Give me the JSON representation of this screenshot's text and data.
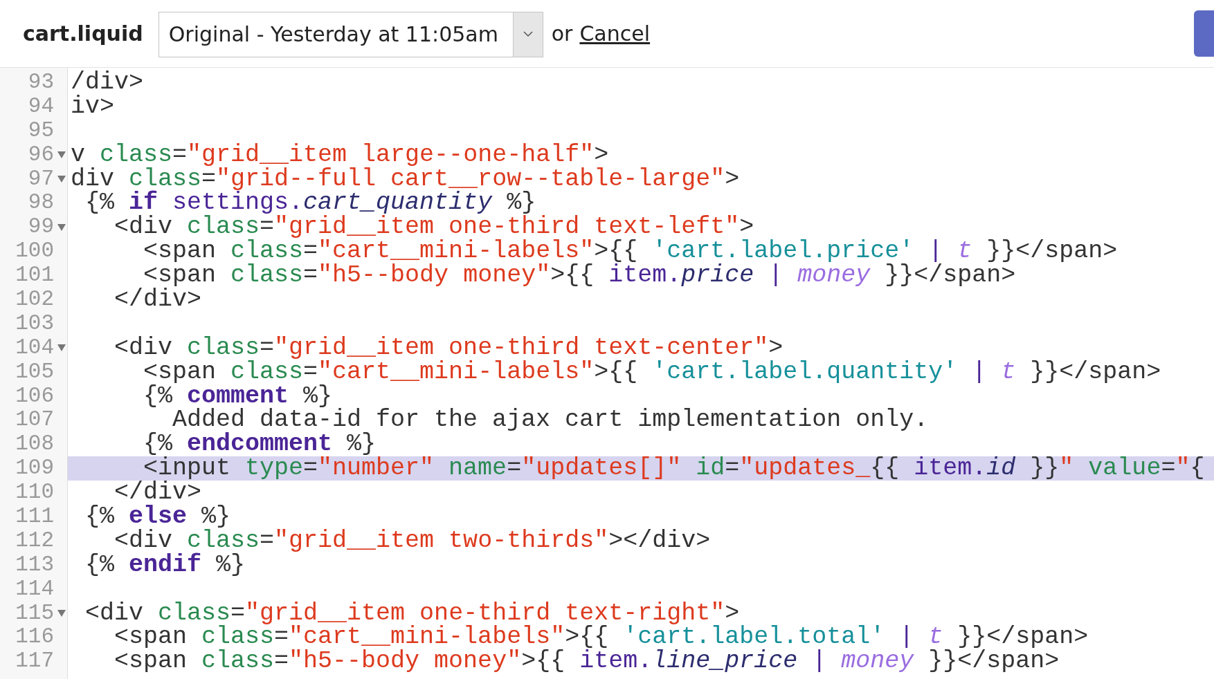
{
  "header": {
    "file_name": "cart.liquid",
    "version_select": {
      "value": "Original - Yesterday at 11:05am"
    },
    "or_text": "or",
    "cancel_link": "Cancel"
  },
  "editor": {
    "lines": [
      {
        "number": "93",
        "foldable": false,
        "selected": false,
        "tokens": [
          {
            "kind": "plain",
            "text": "/div>"
          }
        ]
      },
      {
        "number": "94",
        "foldable": false,
        "selected": false,
        "tokens": [
          {
            "kind": "plain",
            "text": "iv>"
          }
        ]
      },
      {
        "number": "95",
        "foldable": false,
        "selected": false
      },
      {
        "number": "96",
        "foldable": true,
        "selected": false,
        "tokens": [
          {
            "kind": "plain",
            "text": "v "
          },
          {
            "kind": "attr",
            "text": "class"
          },
          {
            "kind": "plain",
            "text": "="
          },
          {
            "kind": "string",
            "text": "\"grid__item large--one-half\""
          },
          {
            "kind": "plain",
            "text": ">"
          }
        ]
      },
      {
        "number": "97",
        "foldable": true,
        "selected": false,
        "tokens": [
          {
            "kind": "plain",
            "text": "div "
          },
          {
            "kind": "attr",
            "text": "class"
          },
          {
            "kind": "plain",
            "text": "="
          },
          {
            "kind": "string",
            "text": "\"grid--full cart__row--table-large\""
          },
          {
            "kind": "plain",
            "text": ">"
          }
        ]
      },
      {
        "number": "98",
        "foldable": false,
        "selected": false,
        "tokens": [
          {
            "kind": "plain",
            "text": " {% "
          },
          {
            "kind": "keyword",
            "text": "if"
          },
          {
            "kind": "variable",
            "text": " settings."
          },
          {
            "kind": "property",
            "text": "cart_quantity"
          },
          {
            "kind": "plain",
            "text": " %}"
          }
        ]
      },
      {
        "number": "99",
        "foldable": true,
        "selected": false,
        "tokens": [
          {
            "kind": "plain",
            "text": "   <div "
          },
          {
            "kind": "attr",
            "text": "class"
          },
          {
            "kind": "plain",
            "text": "="
          },
          {
            "kind": "string",
            "text": "\"grid__item one-third text-left\""
          },
          {
            "kind": "plain",
            "text": ">"
          }
        ]
      },
      {
        "number": "100",
        "foldable": false,
        "selected": false,
        "tokens": [
          {
            "kind": "plain",
            "text": "     <span "
          },
          {
            "kind": "attr",
            "text": "class"
          },
          {
            "kind": "plain",
            "text": "="
          },
          {
            "kind": "string",
            "text": "\"cart__mini-labels\""
          },
          {
            "kind": "plain",
            "text": ">{{ "
          },
          {
            "kind": "literal",
            "text": "'cart.label.price'"
          },
          {
            "kind": "pipe",
            "text": " | "
          },
          {
            "kind": "filter",
            "text": "t"
          },
          {
            "kind": "plain",
            "text": " }}</span>"
          }
        ]
      },
      {
        "number": "101",
        "foldable": false,
        "selected": false,
        "tokens": [
          {
            "kind": "plain",
            "text": "     <span "
          },
          {
            "kind": "attr",
            "text": "class"
          },
          {
            "kind": "plain",
            "text": "="
          },
          {
            "kind": "string",
            "text": "\"h5--body money\""
          },
          {
            "kind": "plain",
            "text": ">{{ "
          },
          {
            "kind": "variable",
            "text": "item."
          },
          {
            "kind": "property",
            "text": "price"
          },
          {
            "kind": "pipe",
            "text": " | "
          },
          {
            "kind": "filter",
            "text": "money"
          },
          {
            "kind": "plain",
            "text": " }}</span>"
          }
        ]
      },
      {
        "number": "102",
        "foldable": false,
        "selected": false,
        "tokens": [
          {
            "kind": "plain",
            "text": "   </div>"
          }
        ]
      },
      {
        "number": "103",
        "foldable": false,
        "selected": false
      },
      {
        "number": "104",
        "foldable": true,
        "selected": false,
        "tokens": [
          {
            "kind": "plain",
            "text": "   <div "
          },
          {
            "kind": "attr",
            "text": "class"
          },
          {
            "kind": "plain",
            "text": "="
          },
          {
            "kind": "string",
            "text": "\"grid__item one-third text-center\""
          },
          {
            "kind": "plain",
            "text": ">"
          }
        ]
      },
      {
        "number": "105",
        "foldable": false,
        "selected": false,
        "tokens": [
          {
            "kind": "plain",
            "text": "     <span "
          },
          {
            "kind": "attr",
            "text": "class"
          },
          {
            "kind": "plain",
            "text": "="
          },
          {
            "kind": "string",
            "text": "\"cart__mini-labels\""
          },
          {
            "kind": "plain",
            "text": ">{{ "
          },
          {
            "kind": "literal",
            "text": "'cart.label.quantity'"
          },
          {
            "kind": "pipe",
            "text": " | "
          },
          {
            "kind": "filter",
            "text": "t"
          },
          {
            "kind": "plain",
            "text": " }}</span>"
          }
        ]
      },
      {
        "number": "106",
        "foldable": false,
        "selected": false,
        "tokens": [
          {
            "kind": "plain",
            "text": "     {% "
          },
          {
            "kind": "keyword",
            "text": "comment"
          },
          {
            "kind": "plain",
            "text": " %}"
          }
        ]
      },
      {
        "number": "107",
        "foldable": false,
        "selected": false,
        "tokens": [
          {
            "kind": "plain",
            "text": "       Added data-id for the ajax cart implementation only."
          }
        ]
      },
      {
        "number": "108",
        "foldable": false,
        "selected": false,
        "tokens": [
          {
            "kind": "plain",
            "text": "     {% "
          },
          {
            "kind": "keyword",
            "text": "endcomment"
          },
          {
            "kind": "plain",
            "text": " %}"
          }
        ]
      },
      {
        "number": "109",
        "foldable": false,
        "selected": true,
        "tokens": [
          {
            "kind": "plain",
            "text": "     <input "
          },
          {
            "kind": "attr",
            "text": "type"
          },
          {
            "kind": "plain",
            "text": "="
          },
          {
            "kind": "string",
            "text": "\"number\""
          },
          {
            "kind": "attr",
            "text": " name"
          },
          {
            "kind": "plain",
            "text": "="
          },
          {
            "kind": "string",
            "text": "\"updates[]\""
          },
          {
            "kind": "attr",
            "text": " id"
          },
          {
            "kind": "plain",
            "text": "="
          },
          {
            "kind": "string",
            "text": "\"updates_"
          },
          {
            "kind": "plain",
            "text": "{{ "
          },
          {
            "kind": "variable",
            "text": "item."
          },
          {
            "kind": "property",
            "text": "id"
          },
          {
            "kind": "plain",
            "text": " }}"
          },
          {
            "kind": "string",
            "text": "\""
          },
          {
            "kind": "attr",
            "text": " value"
          },
          {
            "kind": "plain",
            "text": "="
          },
          {
            "kind": "string",
            "text": "\""
          },
          {
            "kind": "plain",
            "text": "{"
          }
        ]
      },
      {
        "number": "110",
        "foldable": false,
        "selected": false,
        "tokens": [
          {
            "kind": "plain",
            "text": "   </div>"
          }
        ]
      },
      {
        "number": "111",
        "foldable": false,
        "selected": false,
        "tokens": [
          {
            "kind": "plain",
            "text": " {% "
          },
          {
            "kind": "keyword",
            "text": "else"
          },
          {
            "kind": "plain",
            "text": " %}"
          }
        ]
      },
      {
        "number": "112",
        "foldable": false,
        "selected": false,
        "tokens": [
          {
            "kind": "plain",
            "text": "   <div "
          },
          {
            "kind": "attr",
            "text": "class"
          },
          {
            "kind": "plain",
            "text": "="
          },
          {
            "kind": "string",
            "text": "\"grid__item two-thirds\""
          },
          {
            "kind": "plain",
            "text": "></div>"
          }
        ]
      },
      {
        "number": "113",
        "foldable": false,
        "selected": false,
        "tokens": [
          {
            "kind": "plain",
            "text": " {% "
          },
          {
            "kind": "keyword",
            "text": "endif"
          },
          {
            "kind": "plain",
            "text": " %}"
          }
        ]
      },
      {
        "number": "114",
        "foldable": false,
        "selected": false
      },
      {
        "number": "115",
        "foldable": true,
        "selected": false,
        "tokens": [
          {
            "kind": "plain",
            "text": " <div "
          },
          {
            "kind": "attr",
            "text": "class"
          },
          {
            "kind": "plain",
            "text": "="
          },
          {
            "kind": "string",
            "text": "\"grid__item one-third text-right\""
          },
          {
            "kind": "plain",
            "text": ">"
          }
        ]
      },
      {
        "number": "116",
        "foldable": false,
        "selected": false,
        "tokens": [
          {
            "kind": "plain",
            "text": "   <span "
          },
          {
            "kind": "attr",
            "text": "class"
          },
          {
            "kind": "plain",
            "text": "="
          },
          {
            "kind": "string",
            "text": "\"cart__mini-labels\""
          },
          {
            "kind": "plain",
            "text": ">{{ "
          },
          {
            "kind": "literal",
            "text": "'cart.label.total'"
          },
          {
            "kind": "pipe",
            "text": " | "
          },
          {
            "kind": "filter",
            "text": "t"
          },
          {
            "kind": "plain",
            "text": " }}</span>"
          }
        ]
      },
      {
        "number": "117",
        "foldable": false,
        "selected": false,
        "tokens": [
          {
            "kind": "plain",
            "text": "   <span "
          },
          {
            "kind": "attr",
            "text": "class"
          },
          {
            "kind": "plain",
            "text": "="
          },
          {
            "kind": "string",
            "text": "\"h5--body money\""
          },
          {
            "kind": "plain",
            "text": ">{{ "
          },
          {
            "kind": "variable",
            "text": "item."
          },
          {
            "kind": "property",
            "text": "line_price"
          },
          {
            "kind": "pipe",
            "text": " | "
          },
          {
            "kind": "filter",
            "text": "money"
          },
          {
            "kind": "plain",
            "text": " }}</span>"
          }
        ]
      }
    ]
  }
}
